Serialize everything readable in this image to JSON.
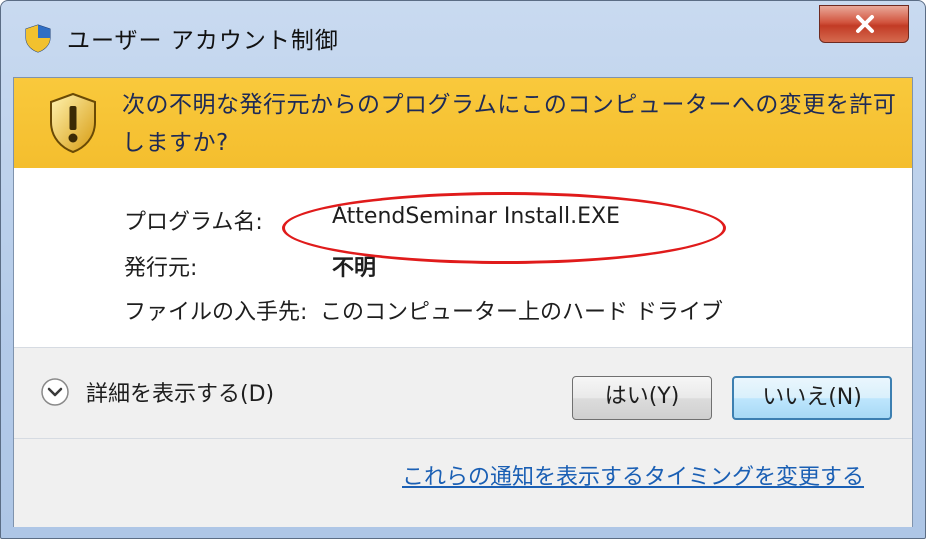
{
  "window": {
    "title": "ユーザー アカウント制御",
    "close_label": "X"
  },
  "banner": {
    "message": "次の不明な発行元からのプログラムにこのコンピューターへの変更を許可しますか?"
  },
  "details": {
    "program_label": "プログラム名:",
    "program_value": "AttendSeminar Install.EXE",
    "publisher_label": "発行元:",
    "publisher_value": "不明",
    "origin_label": "ファイルの入手先:",
    "origin_value": "このコンピューター上のハード ドライブ"
  },
  "footer": {
    "show_details_label": "詳細を表示する(D)",
    "yes_label": "はい(Y)",
    "no_label": "いいえ(N)",
    "notification_link": "これらの通知を表示するタイミングを変更する"
  },
  "icons": {
    "title": "uac-shield-icon",
    "banner": "warning-shield-icon",
    "expand": "chevron-down-icon",
    "close": "close-icon"
  }
}
